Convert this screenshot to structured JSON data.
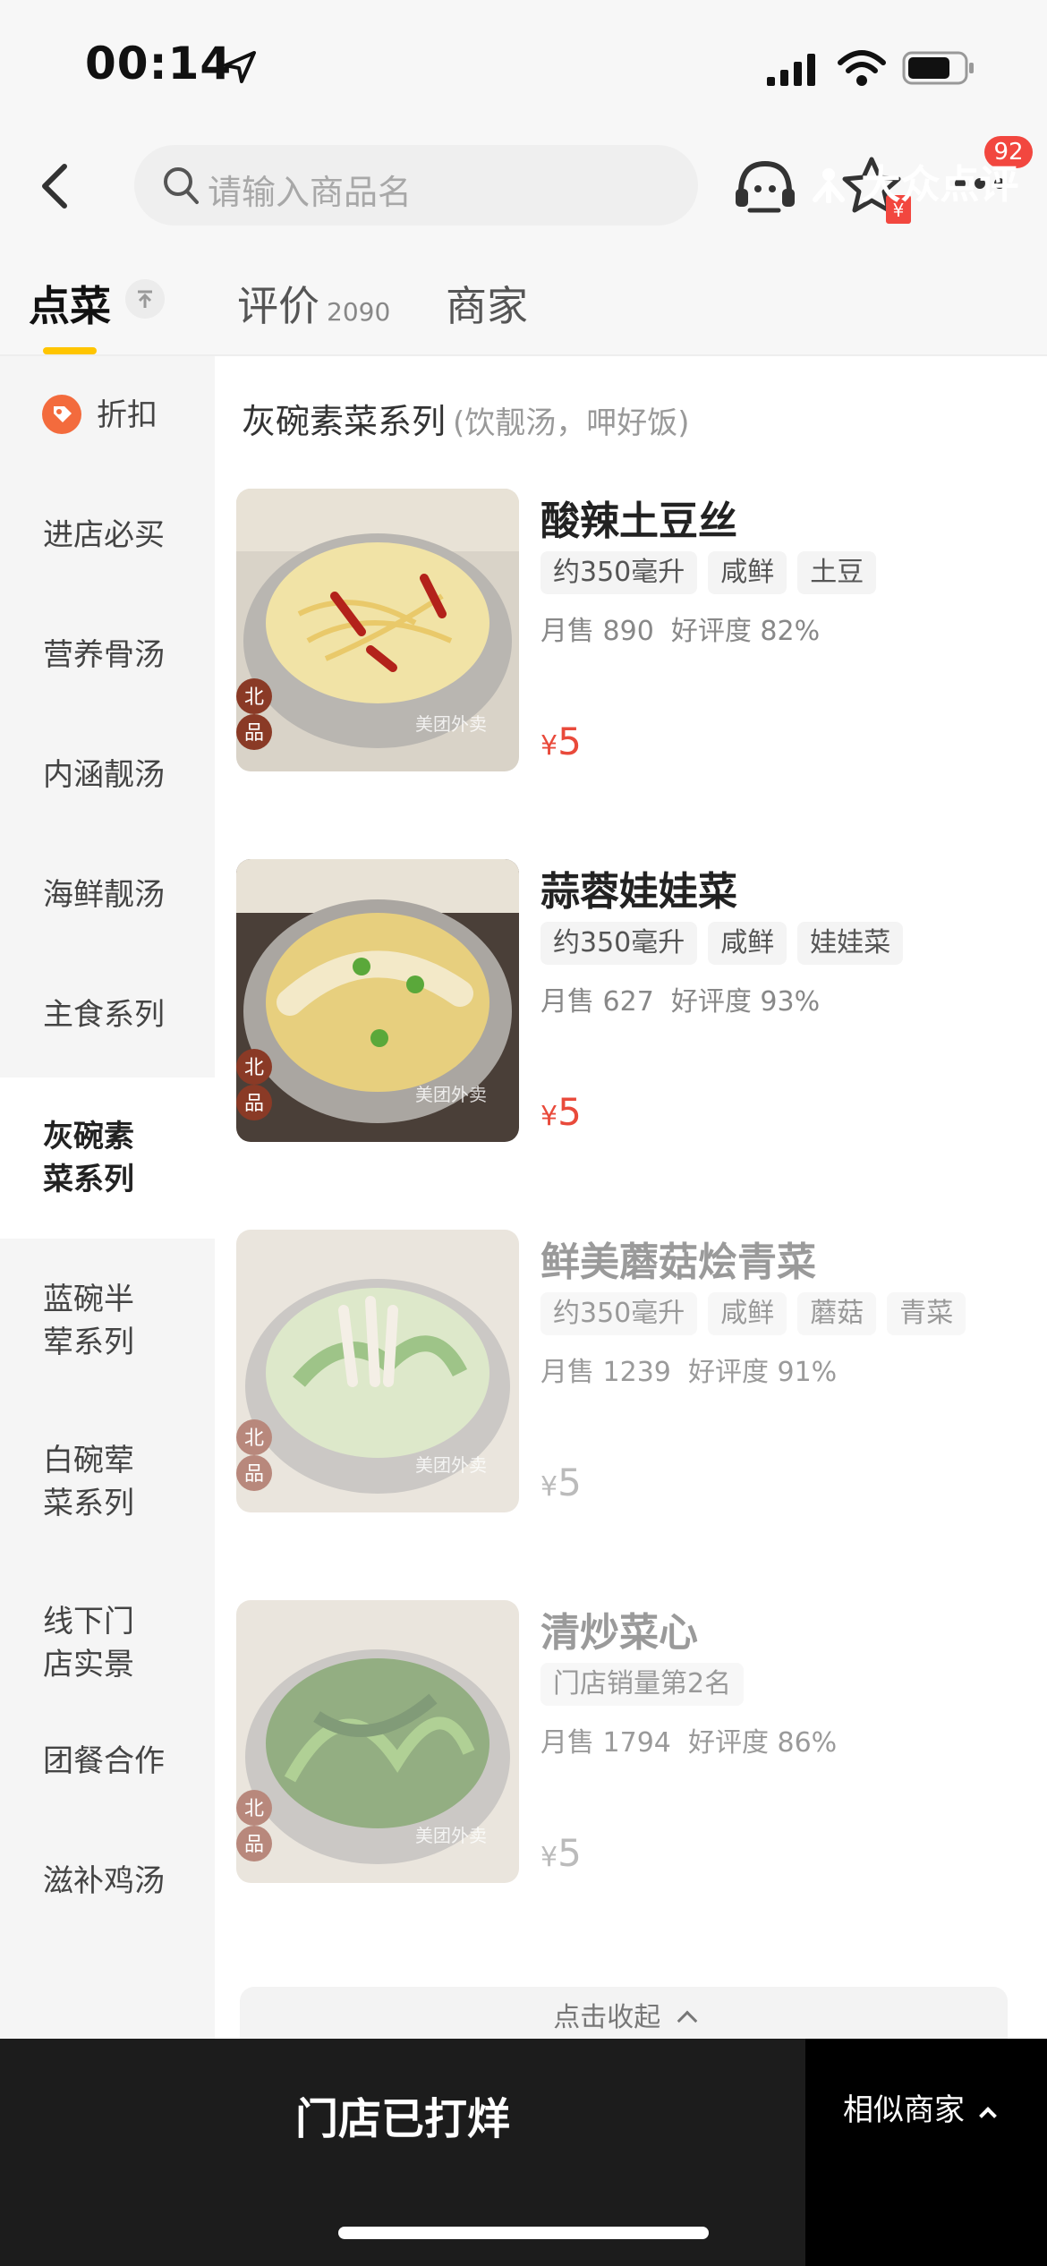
{
  "status_bar": {
    "time": "00:14"
  },
  "header": {
    "search_placeholder": "请输入商品名",
    "more_badge": "92"
  },
  "tabs": [
    {
      "label": "点菜"
    },
    {
      "label": "评价",
      "count": "2090"
    },
    {
      "label": "商家"
    }
  ],
  "sidebar": {
    "items": [
      {
        "label": "折扣"
      },
      {
        "label": "进店必买"
      },
      {
        "label": "营养骨汤"
      },
      {
        "label": "内涵靓汤"
      },
      {
        "label": "海鲜靓汤"
      },
      {
        "label": "主食系列"
      },
      {
        "label": "灰碗素菜系列"
      },
      {
        "label": "蓝碗半荤系列"
      },
      {
        "label": "白碗荤菜系列"
      },
      {
        "label": "线下门店实景"
      },
      {
        "label": "团餐合作"
      },
      {
        "label": "滋补鸡汤"
      }
    ]
  },
  "section": {
    "title": "灰碗素菜系列",
    "subtitle": "(饮靓汤，呷好饭)"
  },
  "dishes": [
    {
      "name": "酸辣土豆丝",
      "tags": [
        "约350毫升",
        "咸鲜",
        "土豆"
      ],
      "sales": "月售 890",
      "rating": "好评度 82%",
      "currency": "¥",
      "price": "5",
      "badge": "北品",
      "watermark": "美团外卖"
    },
    {
      "name": "蒜蓉娃娃菜",
      "tags": [
        "约350毫升",
        "咸鲜",
        "娃娃菜"
      ],
      "sales": "月售 627",
      "rating": "好评度 93%",
      "currency": "¥",
      "price": "5",
      "badge": "北品",
      "watermark": "美团外卖"
    },
    {
      "name": "鲜美蘑菇烩青菜",
      "tags": [
        "约350毫升",
        "咸鲜",
        "蘑菇",
        "青菜"
      ],
      "sales": "月售 1239",
      "rating": "好评度 91%",
      "currency": "¥",
      "price": "5",
      "badge": "北品",
      "watermark": "美团外卖"
    },
    {
      "name": "清炒菜心",
      "tags": [
        "门店销量第2名"
      ],
      "sales": "月售 1794",
      "rating": "好评度 86%",
      "currency": "¥",
      "price": "5",
      "badge": "北品",
      "watermark": "美团外卖"
    }
  ],
  "collapse_label": "点击收起",
  "bottom_bar": {
    "closed_label": "门店已打烊",
    "similar_label": "相似商家",
    "brand": "大众点评"
  },
  "colors": {
    "accent": "#ffc500",
    "price": "#e94a3b",
    "badge": "#f2473f"
  }
}
